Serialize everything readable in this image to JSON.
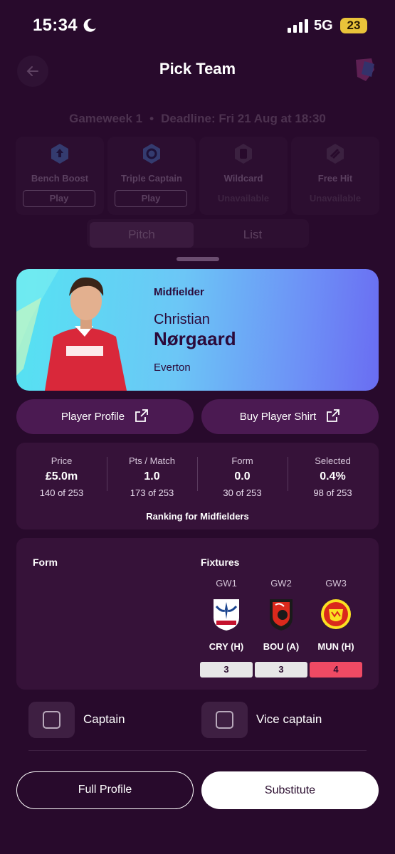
{
  "status_bar": {
    "time": "15:34",
    "network": "5G",
    "battery": "23"
  },
  "header": {
    "title": "Pick Team"
  },
  "gameweek": {
    "label": "Gameweek 1",
    "deadline": "Deadline: Fri 21 Aug at 18:30"
  },
  "chips": [
    {
      "name": "Bench Boost",
      "action": "Play"
    },
    {
      "name": "Triple Captain",
      "action": "Play"
    },
    {
      "name": "Wildcard",
      "status": "Unavailable"
    },
    {
      "name": "Free Hit",
      "status": "Unavailable"
    }
  ],
  "view_toggle": {
    "pitch": "Pitch",
    "list": "List"
  },
  "player": {
    "position": "Midfielder",
    "first_name": "Christian",
    "last_name": "Nørgaard",
    "club": "Everton"
  },
  "links": {
    "profile": "Player Profile",
    "shirt": "Buy Player Shirt"
  },
  "stats": [
    {
      "label": "Price",
      "value": "£5.0m",
      "rank": "140 of 253"
    },
    {
      "label": "Pts / Match",
      "value": "1.0",
      "rank": "173 of 253"
    },
    {
      "label": "Form",
      "value": "0.0",
      "rank": "30 of 253"
    },
    {
      "label": "Selected",
      "value": "0.4%",
      "rank": "98 of 253"
    }
  ],
  "ranking_note": "Ranking for Midfielders",
  "form_section": {
    "form_title": "Form",
    "fixtures_title": "Fixtures"
  },
  "fixtures": [
    {
      "gw": "GW1",
      "opponent": "CRY (H)",
      "difficulty": "3",
      "difficulty_color": "#e7e7e7"
    },
    {
      "gw": "GW2",
      "opponent": "BOU (A)",
      "difficulty": "3",
      "difficulty_color": "#e7e7e7"
    },
    {
      "gw": "GW3",
      "opponent": "MUN (H)",
      "difficulty": "4",
      "difficulty_color": "#ef4a64"
    }
  ],
  "captain": {
    "captain_label": "Captain",
    "vice_label": "Vice captain"
  },
  "actions": {
    "full_profile": "Full Profile",
    "substitute": "Substitute"
  },
  "colors": {
    "background": "#280a2c",
    "card": "#361239",
    "button": "#4b1a52",
    "hero_start": "#55e3f2",
    "hero_end": "#6a6df2"
  }
}
